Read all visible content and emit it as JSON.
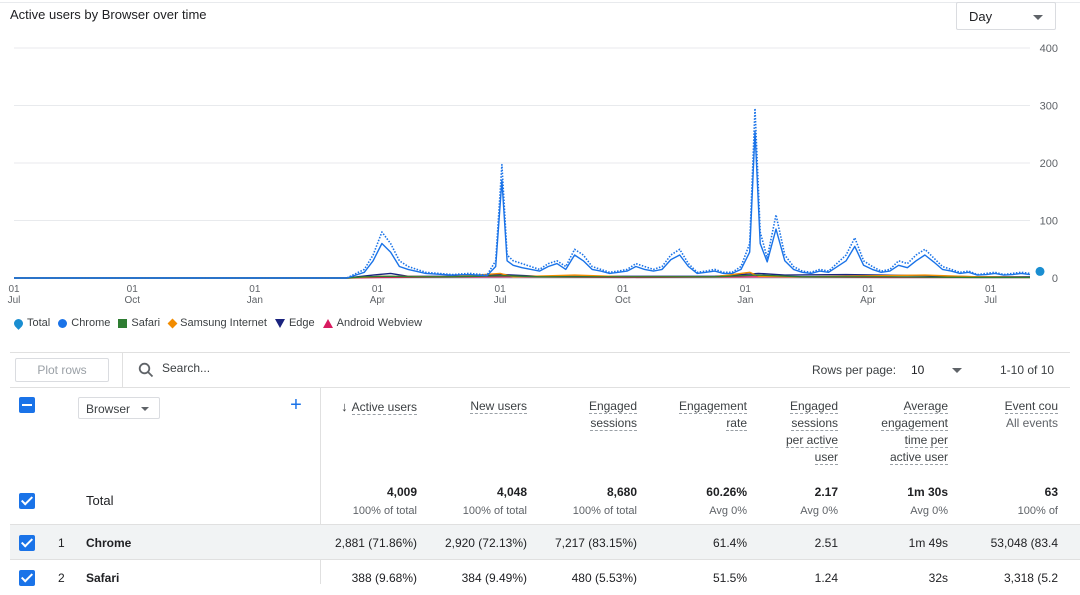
{
  "chart": {
    "title": "Active users by Browser over time",
    "granularity": "Day",
    "y_ticks": [
      "400",
      "300",
      "200",
      "100",
      "0"
    ],
    "x_ticks": [
      {
        "day": "01",
        "month": "Jul"
      },
      {
        "day": "01",
        "month": "Oct"
      },
      {
        "day": "01",
        "month": "Jan"
      },
      {
        "day": "01",
        "month": "Apr"
      },
      {
        "day": "01",
        "month": "Jul"
      },
      {
        "day": "01",
        "month": "Oct"
      },
      {
        "day": "01",
        "month": "Jan"
      },
      {
        "day": "01",
        "month": "Apr"
      },
      {
        "day": "01",
        "month": "Jul"
      }
    ]
  },
  "chart_data": {
    "type": "line",
    "ylim": [
      0,
      400
    ],
    "grid": true,
    "legend_position": "bottom-left",
    "series": [
      {
        "name": "Total",
        "color": "#1a73e8",
        "style": "dotted",
        "marker": "pin",
        "points": [
          [
            0,
            0
          ],
          [
            38,
            0
          ],
          [
            40,
            15
          ],
          [
            41,
            40
          ],
          [
            42,
            80
          ],
          [
            43,
            60
          ],
          [
            44,
            30
          ],
          [
            45,
            20
          ],
          [
            47,
            10
          ],
          [
            50,
            6
          ],
          [
            52,
            8
          ],
          [
            54,
            5
          ],
          [
            55,
            30
          ],
          [
            55.7,
            197
          ],
          [
            56.3,
            40
          ],
          [
            57,
            30
          ],
          [
            58,
            25
          ],
          [
            60,
            15
          ],
          [
            61,
            25
          ],
          [
            62,
            30
          ],
          [
            63,
            20
          ],
          [
            64,
            50
          ],
          [
            65,
            40
          ],
          [
            66,
            20
          ],
          [
            67,
            15
          ],
          [
            68,
            10
          ],
          [
            69,
            12
          ],
          [
            70,
            15
          ],
          [
            71,
            25
          ],
          [
            72,
            20
          ],
          [
            73,
            15
          ],
          [
            74,
            20
          ],
          [
            75,
            40
          ],
          [
            76,
            50
          ],
          [
            77,
            25
          ],
          [
            78,
            10
          ],
          [
            79,
            12
          ],
          [
            80,
            15
          ],
          [
            81,
            10
          ],
          [
            82,
            10
          ],
          [
            83,
            20
          ],
          [
            84,
            60
          ],
          [
            84.6,
            295
          ],
          [
            85.2,
            80
          ],
          [
            86,
            35
          ],
          [
            87,
            110
          ],
          [
            88,
            40
          ],
          [
            89,
            20
          ],
          [
            90,
            12
          ],
          [
            91,
            10
          ],
          [
            92,
            15
          ],
          [
            93,
            12
          ],
          [
            95,
            40
          ],
          [
            96,
            70
          ],
          [
            97,
            30
          ],
          [
            98,
            20
          ],
          [
            99,
            12
          ],
          [
            100,
            15
          ],
          [
            101,
            30
          ],
          [
            102,
            25
          ],
          [
            103,
            40
          ],
          [
            104,
            50
          ],
          [
            105,
            35
          ],
          [
            106,
            20
          ],
          [
            107,
            15
          ],
          [
            108,
            10
          ],
          [
            109,
            12
          ],
          [
            110,
            6
          ],
          [
            111,
            8
          ],
          [
            112,
            10
          ],
          [
            113,
            6
          ],
          [
            114,
            8
          ],
          [
            115,
            10
          ],
          [
            116,
            8
          ]
        ]
      },
      {
        "name": "Chrome",
        "color": "#1a73e8",
        "style": "solid",
        "marker": "circle",
        "points": [
          [
            0,
            0
          ],
          [
            38,
            0
          ],
          [
            40,
            10
          ],
          [
            41,
            30
          ],
          [
            42,
            60
          ],
          [
            43,
            45
          ],
          [
            44,
            20
          ],
          [
            45,
            15
          ],
          [
            47,
            8
          ],
          [
            50,
            5
          ],
          [
            52,
            6
          ],
          [
            54,
            4
          ],
          [
            55,
            20
          ],
          [
            55.7,
            170
          ],
          [
            56.3,
            30
          ],
          [
            57,
            22
          ],
          [
            58,
            18
          ],
          [
            60,
            12
          ],
          [
            61,
            20
          ],
          [
            62,
            25
          ],
          [
            63,
            15
          ],
          [
            64,
            40
          ],
          [
            65,
            30
          ],
          [
            66,
            15
          ],
          [
            67,
            12
          ],
          [
            68,
            8
          ],
          [
            69,
            10
          ],
          [
            70,
            12
          ],
          [
            71,
            20
          ],
          [
            72,
            15
          ],
          [
            73,
            12
          ],
          [
            74,
            15
          ],
          [
            75,
            32
          ],
          [
            76,
            40
          ],
          [
            77,
            20
          ],
          [
            78,
            8
          ],
          [
            79,
            10
          ],
          [
            80,
            12
          ],
          [
            81,
            8
          ],
          [
            82,
            8
          ],
          [
            83,
            15
          ],
          [
            84,
            45
          ],
          [
            84.6,
            255
          ],
          [
            85.2,
            60
          ],
          [
            86,
            28
          ],
          [
            87,
            85
          ],
          [
            88,
            30
          ],
          [
            89,
            15
          ],
          [
            90,
            10
          ],
          [
            91,
            8
          ],
          [
            92,
            12
          ],
          [
            93,
            10
          ],
          [
            95,
            30
          ],
          [
            96,
            55
          ],
          [
            97,
            22
          ],
          [
            98,
            15
          ],
          [
            99,
            10
          ],
          [
            100,
            12
          ],
          [
            101,
            22
          ],
          [
            102,
            18
          ],
          [
            103,
            30
          ],
          [
            104,
            40
          ],
          [
            105,
            28
          ],
          [
            106,
            15
          ],
          [
            107,
            12
          ],
          [
            108,
            8
          ],
          [
            109,
            10
          ],
          [
            110,
            5
          ],
          [
            111,
            6
          ],
          [
            112,
            8
          ],
          [
            113,
            5
          ],
          [
            114,
            6
          ],
          [
            115,
            8
          ],
          [
            116,
            6
          ]
        ]
      },
      {
        "name": "Safari",
        "color": "#2e7d32",
        "style": "solid",
        "marker": "square",
        "points": [
          [
            0,
            0
          ],
          [
            38,
            0
          ],
          [
            40,
            2
          ],
          [
            43,
            3
          ],
          [
            46,
            2
          ],
          [
            50,
            2
          ],
          [
            56,
            4
          ],
          [
            60,
            2
          ],
          [
            70,
            2
          ],
          [
            80,
            2
          ],
          [
            85,
            5
          ],
          [
            90,
            2
          ],
          [
            100,
            2
          ],
          [
            110,
            1
          ],
          [
            116,
            1
          ]
        ]
      },
      {
        "name": "Samsung Internet",
        "color": "#f28c00",
        "style": "solid",
        "marker": "diamond",
        "points": [
          [
            0,
            0
          ],
          [
            38,
            0
          ],
          [
            42,
            3
          ],
          [
            50,
            2
          ],
          [
            55.5,
            8
          ],
          [
            57,
            2
          ],
          [
            64,
            5
          ],
          [
            70,
            2
          ],
          [
            80,
            2
          ],
          [
            84,
            10
          ],
          [
            85,
            3
          ],
          [
            90,
            2
          ],
          [
            104,
            5
          ],
          [
            110,
            2
          ],
          [
            116,
            1
          ]
        ]
      },
      {
        "name": "Edge",
        "color": "#1a237e",
        "style": "solid",
        "marker": "triangle-down",
        "points": [
          [
            0,
            0
          ],
          [
            38,
            0
          ],
          [
            41,
            5
          ],
          [
            43,
            8
          ],
          [
            45,
            3
          ],
          [
            50,
            3
          ],
          [
            56,
            6
          ],
          [
            60,
            3
          ],
          [
            70,
            3
          ],
          [
            80,
            3
          ],
          [
            85,
            8
          ],
          [
            88,
            5
          ],
          [
            95,
            6
          ],
          [
            104,
            4
          ],
          [
            110,
            2
          ],
          [
            116,
            2
          ]
        ]
      },
      {
        "name": "Android Webview",
        "color": "#d81b60",
        "style": "solid",
        "marker": "triangle-up",
        "points": [
          [
            0,
            0
          ],
          [
            38,
            0
          ],
          [
            42,
            1
          ],
          [
            56,
            2
          ],
          [
            70,
            1
          ],
          [
            85,
            2
          ],
          [
            100,
            1
          ],
          [
            116,
            1
          ]
        ]
      }
    ]
  },
  "legend": [
    {
      "label": "Total",
      "shape": "pin",
      "color": "#1a73e8"
    },
    {
      "label": "Chrome",
      "shape": "circle",
      "color": "#1a73e8"
    },
    {
      "label": "Safari",
      "shape": "square",
      "color": "#2e7d32"
    },
    {
      "label": "Samsung Internet",
      "shape": "diamond",
      "color": "#f28c00"
    },
    {
      "label": "Edge",
      "shape": "tri-down",
      "color": "#1a237e"
    },
    {
      "label": "Android Webview",
      "shape": "tri-up",
      "color": "#d81b60"
    }
  ],
  "toolbar": {
    "plot_rows_label": "Plot rows",
    "search_placeholder": "Search...",
    "rows_per_page_label": "Rows per page:",
    "rows_per_page": "10",
    "page_range": "1-10 of 10"
  },
  "table": {
    "dimension": "Browser",
    "columns": [
      {
        "lines": [
          "Active users"
        ],
        "sorted": true
      },
      {
        "lines": [
          "New users"
        ]
      },
      {
        "lines": [
          "Engaged",
          "sessions"
        ]
      },
      {
        "lines": [
          "Engagement",
          "rate"
        ]
      },
      {
        "lines": [
          "Engaged",
          "sessions",
          "per active",
          "user"
        ]
      },
      {
        "lines": [
          "Average",
          "engagement",
          "time per",
          "active user"
        ]
      },
      {
        "lines": [
          "Event cou"
        ],
        "sub": "All events"
      }
    ],
    "total": {
      "label": "Total",
      "values": [
        "4,009",
        "4,048",
        "8,680",
        "60.26%",
        "2.17",
        "1m 30s",
        "63"
      ],
      "subs": [
        "100% of total",
        "100% of total",
        "100% of total",
        "Avg 0%",
        "Avg 0%",
        "Avg 0%",
        "100% of"
      ]
    },
    "rows": [
      {
        "num": "1",
        "name": "Chrome",
        "values": [
          "2,881 (71.86%)",
          "2,920 (72.13%)",
          "7,217 (83.15%)",
          "61.4%",
          "2.51",
          "1m 49s",
          "53,048 (83.4"
        ]
      },
      {
        "num": "2",
        "name": "Safari",
        "values": [
          "388 (9.68%)",
          "384 (9.49%)",
          "480 (5.53%)",
          "51.5%",
          "1.24",
          "32s",
          "3,318 (5.2"
        ]
      }
    ]
  },
  "colors": {
    "accent": "#1a73e8"
  },
  "icons": [
    "search-icon",
    "chevron-down-icon",
    "add-icon",
    "sort-arrow-down-icon"
  ]
}
